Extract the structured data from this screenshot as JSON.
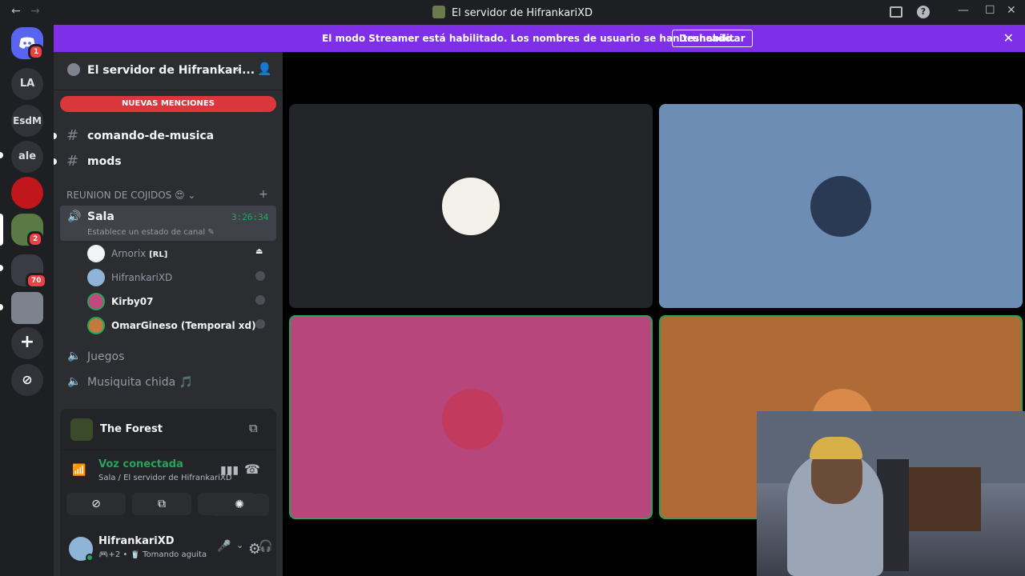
{
  "titlebar": {
    "back": "←",
    "forward": "→",
    "title": "El servidor de HifrankariXD",
    "minimize": "—",
    "maximize": "☐",
    "close": "✕",
    "help": "?"
  },
  "banner": {
    "message": "El modo Streamer está habilitado. Los nombres de usuario se han truncado.",
    "button": "Deshabilitar",
    "close": "✕",
    "color": "#7f2fe8"
  },
  "guilds": {
    "home_badge": "1",
    "items": [
      {
        "label": "LA"
      },
      {
        "label": "EsdM"
      },
      {
        "label": "ale"
      },
      {
        "label": ""
      },
      {
        "label": "",
        "badge": "2"
      },
      {
        "label": "",
        "badge": "70"
      },
      {
        "label": ""
      }
    ],
    "add": "+",
    "explore": "⊘"
  },
  "server": {
    "name": "El servidor de Hifrankari...",
    "new_mentions": "NUEVAS MENCIONES",
    "channels": [
      {
        "name": "comando-de-musica"
      },
      {
        "name": "mods"
      }
    ],
    "category": "REUNION DE COJIDOS",
    "voice_channel": {
      "name": "Sala",
      "time": "3:26:34",
      "status": "Establece un estado de canal"
    },
    "members": [
      {
        "name": "Arnorix",
        "tag": "[RL]",
        "color": "#dbdee1"
      },
      {
        "name": "HifrankariXD",
        "color": "#949ba4"
      },
      {
        "name": "Kirby07",
        "color": "#f2f3f5"
      },
      {
        "name": "OmarGineso (Temporal xd)",
        "color": "#f2f3f5"
      }
    ],
    "other_voice": [
      {
        "name": "Juegos"
      },
      {
        "name": "Musiquita chida 🎵"
      }
    ]
  },
  "panel": {
    "activity": "The Forest",
    "voice_status": "Voz conectada",
    "voice_location": "Sala / El servidor de HifrankariXD",
    "user": {
      "name": "HifrankariXD",
      "status": "🎮+2 • 🥤 Tomando aguita"
    }
  },
  "tiles": [
    {
      "bg": "#232428",
      "speaking": false
    },
    {
      "bg": "#6e8db5",
      "speaking": false
    },
    {
      "bg": "#b7467c",
      "speaking": true
    },
    {
      "bg": "#b06a35",
      "speaking": true
    }
  ]
}
